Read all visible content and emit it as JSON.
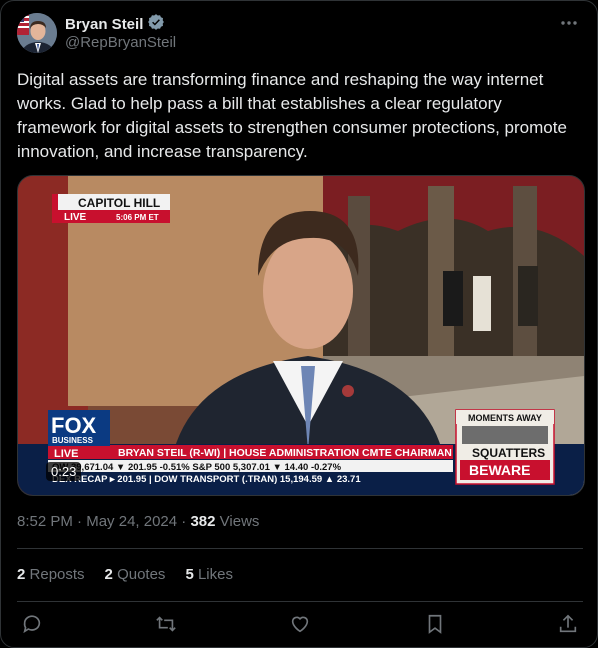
{
  "author": {
    "name": "Bryan Steil",
    "handle": "@RepBryanSteil"
  },
  "tweet": {
    "text": "Digital assets are transforming finance and reshaping the way internet works. Glad to help pass a bill that establishes a clear regulatory framework for digital assets to strengthen consumer protections, promote innovation, and increase transparency."
  },
  "video": {
    "location_label": "CAPITOL HILL",
    "live_label": "LIVE",
    "live_time": "5:06 PM ET",
    "network_name": "FOX",
    "network_sub": "BUSINESS",
    "network_live": "LIVE",
    "chyron_name": "BRYAN STEIL (R-WI) | HOUSE ADMINISTRATION CMTE CHAIRMAN",
    "ticker_row1": "OW    39,671.04 ▼ 201.95  -0.51%  S&P 500    5,307.01 ▼ 14.40  -0.27%",
    "ticker_row2": "DEX RECAP  ▸  201.95  |  DOW TRANSPORT (.TRAN)  15,194.59 ▲ 23.71",
    "promo_top": "MOMENTS AWAY",
    "promo_line1": "SQUATTERS",
    "promo_line2": "BEWARE",
    "duration": "0:23"
  },
  "meta": {
    "time": "8:52 PM",
    "date": "May 24, 2024",
    "views_count": "382",
    "views_label": "Views"
  },
  "stats": {
    "reposts_count": "2",
    "reposts_label": "Reposts",
    "quotes_count": "2",
    "quotes_label": "Quotes",
    "likes_count": "5",
    "likes_label": "Likes"
  },
  "colors": {
    "verified": "#829aab",
    "muted": "#71767b",
    "text": "#e7e9ea",
    "fox_red": "#c8102e",
    "fox_blue": "#0b3a82"
  },
  "icons": [
    "verified-badge-icon",
    "more-icon",
    "reply-icon",
    "repost-icon",
    "like-icon",
    "bookmark-icon",
    "share-icon"
  ]
}
